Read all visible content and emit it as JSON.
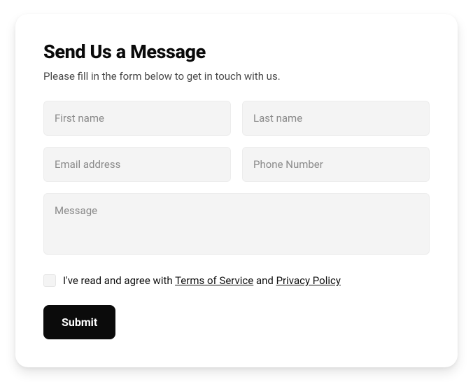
{
  "form": {
    "title": "Send Us a Message",
    "subtitle": "Please fill in the form below to get in touch with us.",
    "fields": {
      "first_name": {
        "placeholder": "First name",
        "value": ""
      },
      "last_name": {
        "placeholder": "Last name",
        "value": ""
      },
      "email": {
        "placeholder": "Email address",
        "value": ""
      },
      "phone": {
        "placeholder": "Phone Number",
        "value": ""
      },
      "message": {
        "placeholder": "Message",
        "value": ""
      }
    },
    "consent": {
      "checked": false,
      "prefix": "I've read and agree with ",
      "tos_label": "Terms of Service",
      "middle": " and ",
      "privacy_label": "Privacy Policy"
    },
    "submit_label": "Submit"
  }
}
